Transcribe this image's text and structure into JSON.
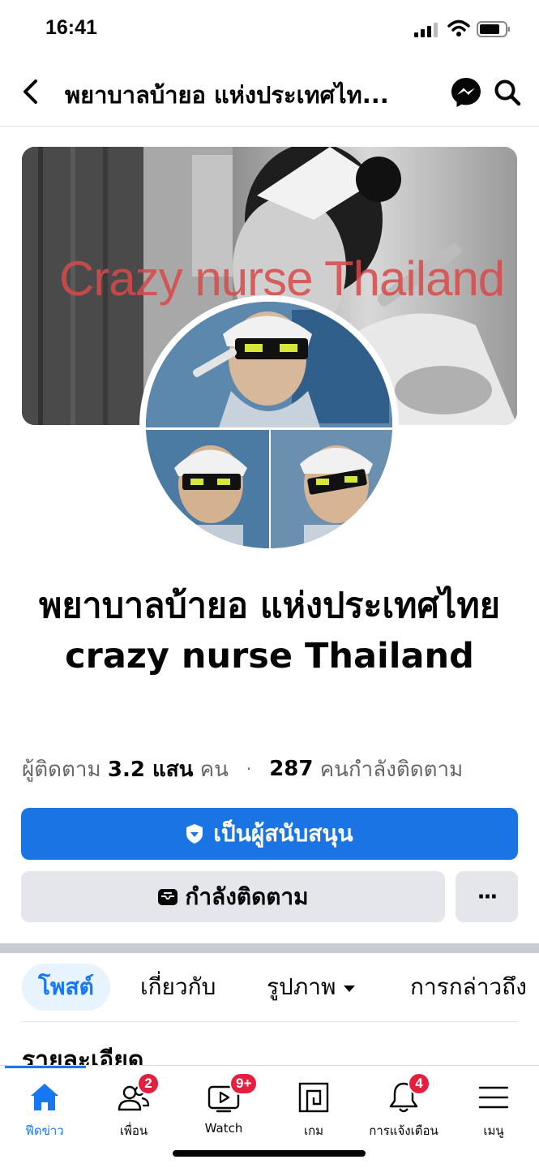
{
  "status_bar": {
    "time": "16:41",
    "signal_icon": "cellular-signal-icon",
    "wifi_icon": "wifi-icon",
    "battery_icon": "battery-icon"
  },
  "header": {
    "title": "พยาบาลบ้ายอ แห่งประเทศไท...",
    "back_icon": "chevron-left-icon",
    "messenger_icon": "messenger-icon",
    "search_icon": "search-icon"
  },
  "cover": {
    "overlay_text": "Crazy nurse Thailand"
  },
  "page": {
    "name": "พยาบาลบ้ายอ แห่งประเทศไทย crazy nurse Thailand"
  },
  "stats": {
    "followers_label": "ผู้ติดตาม",
    "followers_count": "3.2 แสน",
    "followers_unit": "คน",
    "separator": "·",
    "following_count": "287",
    "following_label": "คนกำลังติดตาม"
  },
  "actions": {
    "supporter_label": "เป็นผู้สนับสนุน",
    "following_label": "กำลังติดตาม",
    "more_label": "···"
  },
  "tabs": [
    {
      "label": "โพสต์",
      "active": true
    },
    {
      "label": "เกี่ยวกับ",
      "active": false
    },
    {
      "label": "รูปภาพ",
      "active": false
    },
    {
      "label": "การกล่าวถึง",
      "active": false
    }
  ],
  "details_heading": "รายละเอียด",
  "bottom_nav": [
    {
      "label": "ฟีดข่าว",
      "icon": "home-icon",
      "badge": "",
      "active": true
    },
    {
      "label": "เพื่อน",
      "icon": "friends-icon",
      "badge": "2",
      "active": false
    },
    {
      "label": "Watch",
      "icon": "watch-icon",
      "badge": "9+",
      "active": false
    },
    {
      "label": "เกม",
      "icon": "gaming-icon",
      "badge": "",
      "active": false
    },
    {
      "label": "การแจ้งเตือน",
      "icon": "bell-icon",
      "badge": "4",
      "active": false
    },
    {
      "label": "เมนู",
      "icon": "menu-icon",
      "badge": "",
      "active": false
    }
  ],
  "colors": {
    "accent": "#1b74e4",
    "badge": "#e41e3f",
    "secondary_button": "#e4e6eb",
    "muted_text": "#65676b"
  }
}
